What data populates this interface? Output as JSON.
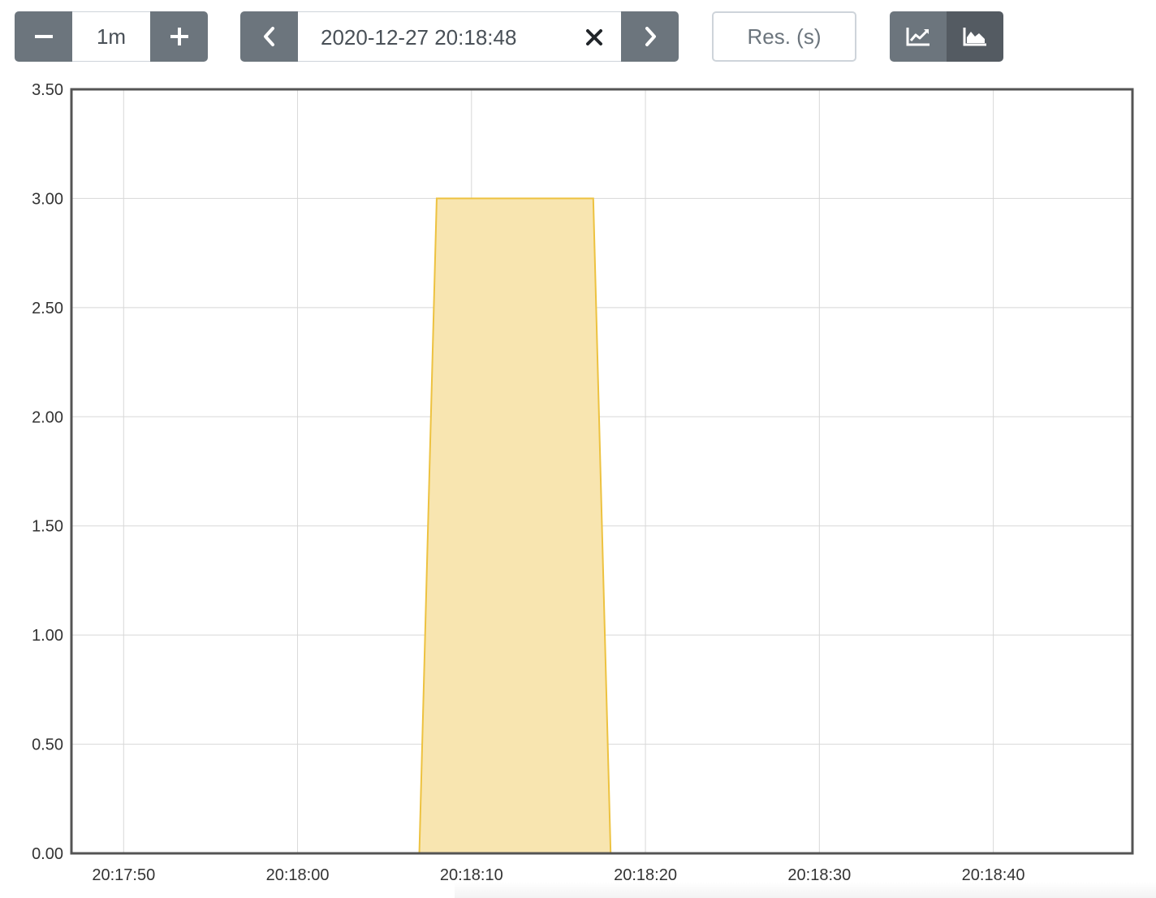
{
  "toolbar": {
    "range": {
      "value": "1m"
    },
    "end_time": {
      "value": "2020-12-27 20:18:48"
    },
    "resolution": {
      "placeholder": "Res. (s)"
    }
  },
  "colors": {
    "button_bg": "#6c757d",
    "button_active_bg": "#545b62",
    "series_stroke": "#edc240",
    "series_fill": "#f8e5b0",
    "grid": "#d8d8d8",
    "plot_border": "#545454"
  },
  "icons": [
    "minus-icon",
    "plus-icon",
    "chevron-left-icon",
    "close-icon",
    "chevron-right-icon",
    "line-chart-icon",
    "area-chart-icon"
  ],
  "chart_data": {
    "type": "area",
    "x_range": [
      "20:17:47",
      "20:18:48"
    ],
    "ylim": [
      0,
      3.5
    ],
    "x_ticks": [
      "20:17:50",
      "20:18:00",
      "20:18:10",
      "20:18:20",
      "20:18:30",
      "20:18:40"
    ],
    "y_ticks": [
      "0.00",
      "0.50",
      "1.00",
      "1.50",
      "2.00",
      "2.50",
      "3.00",
      "3.50"
    ],
    "grid": true,
    "series": [
      {
        "x": [
          "20:17:57",
          "20:18:07",
          "20:18:08",
          "20:18:17",
          "20:18:18",
          "20:18:48"
        ],
        "values": [
          0,
          0,
          3,
          3,
          0,
          0
        ]
      }
    ]
  }
}
